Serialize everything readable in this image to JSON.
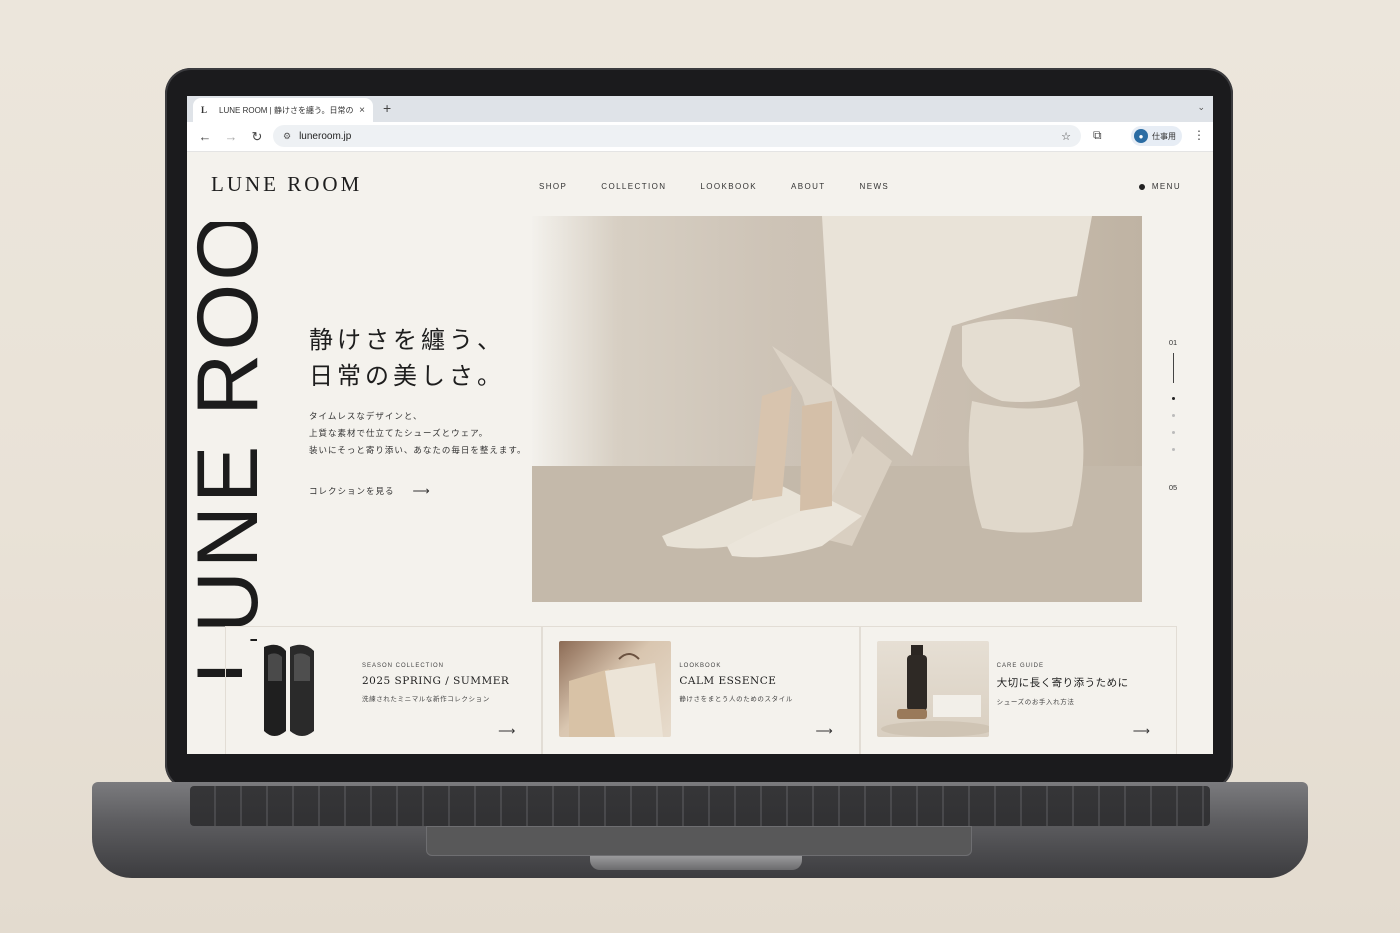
{
  "browser": {
    "tab_favicon": "L",
    "tab_title": "LUNE ROOM | 静けさを纏う。日常の",
    "tab_close": "×",
    "new_tab": "+",
    "tab_menu": "⌄",
    "back": "←",
    "forward": "→",
    "reload": "↻",
    "site_settings": "⚙",
    "url": "luneroom.jp",
    "bookmark": "☆",
    "extensions": "⧉",
    "profile_avatar": "●",
    "profile_name": "仕事用",
    "more": "⋮"
  },
  "header": {
    "logo": "LUNE ROOM",
    "nav": [
      "SHOP",
      "COLLECTION",
      "LOOKBOOK",
      "ABOUT",
      "NEWS"
    ],
    "menu_label": "MENU"
  },
  "hero": {
    "vertical_text": "LUNE ROOM",
    "headline": [
      "静けさを纏う、",
      "日常の美しさ。"
    ],
    "lead": [
      "タイムレスなデザインと、",
      "上質な素材で仕立てたシューズとウェア。",
      "装いにそっと寄り添い、あなたの毎日を整えます。"
    ],
    "cta_label": "コレクションを見る",
    "cta_arrow": "⟶"
  },
  "pager": {
    "current": "01",
    "total": "05",
    "active_index": 0,
    "count": 4
  },
  "cards": [
    {
      "kicker": "SEASON COLLECTION",
      "title": "2025 SPRING / SUMMER",
      "desc": "洗練されたミニマルな新作コレクション",
      "arrow": "⟶"
    },
    {
      "kicker": "LOOKBOOK",
      "title": "CALM ESSENCE",
      "desc": "静けさをまとう人のためのスタイル",
      "arrow": "⟶"
    },
    {
      "kicker": "CARE GUIDE",
      "title": "大切に長く寄り添うために",
      "desc": "シューズのお手入れ方法",
      "arrow": "⟶"
    }
  ],
  "colors": {
    "page_bg": "#f4f2ed",
    "ink": "#1e1e1e",
    "hero_tone": "#cdc3b6"
  }
}
